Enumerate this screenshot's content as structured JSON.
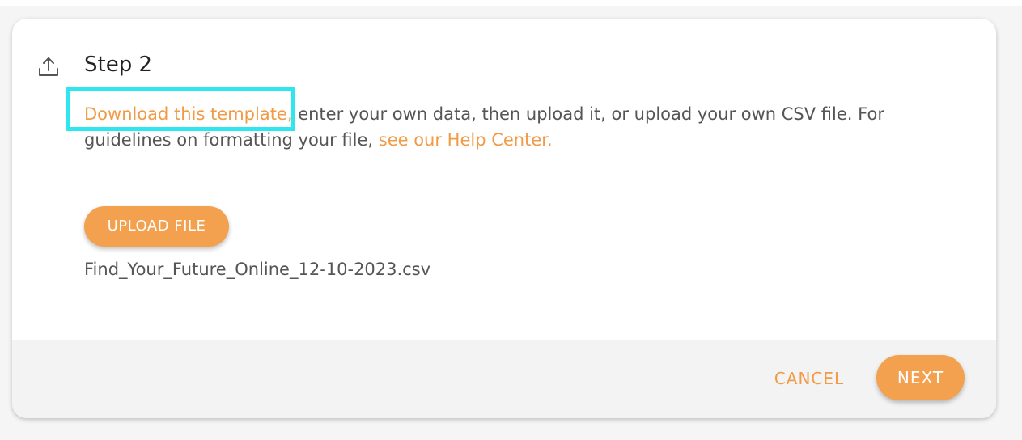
{
  "step": {
    "icon": "upload-icon",
    "title": "Step 2"
  },
  "description": {
    "template_link": "Download this template,",
    "text_part1": " enter your own data, then upload it, or upload your own CSV file. For guidelines on formatting your file, ",
    "help_link": "see our Help Center."
  },
  "upload": {
    "button_label": "UPLOAD FILE",
    "file_name": "Find_Your_Future_Online_12-10-2023.csv"
  },
  "footer": {
    "cancel_label": "CANCEL",
    "next_label": "NEXT"
  },
  "colors": {
    "accent": "#f3a04f",
    "link": "#f29a45",
    "highlight": "#2ee6f0"
  }
}
